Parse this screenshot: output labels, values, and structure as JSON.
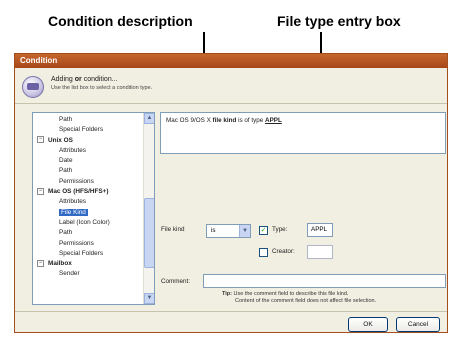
{
  "callouts": {
    "condition_description": "Condition description",
    "file_type_entry_box": "File type entry box"
  },
  "dialog": {
    "title": "Condition",
    "header_title_pre": "Adding ",
    "header_title_bold": "or",
    "header_title_post": " condition...",
    "header_subtitle": "Use the list box to select a condition type."
  },
  "tree": {
    "items": [
      {
        "label": "Path",
        "kind": "child"
      },
      {
        "label": "Special Folders",
        "kind": "child"
      },
      {
        "label": "Unix OS",
        "kind": "group",
        "expander": "−"
      },
      {
        "label": "Attributes",
        "kind": "child"
      },
      {
        "label": "Date",
        "kind": "child"
      },
      {
        "label": "Path",
        "kind": "child"
      },
      {
        "label": "Permissions",
        "kind": "child"
      },
      {
        "label": "Mac OS (HFS/HFS+)",
        "kind": "group",
        "expander": "−"
      },
      {
        "label": "Attributes",
        "kind": "child"
      },
      {
        "label": "File Kind",
        "kind": "child",
        "selected": true
      },
      {
        "label": "Label (Icon Color)",
        "kind": "child"
      },
      {
        "label": "Path",
        "kind": "child"
      },
      {
        "label": "Permissions",
        "kind": "child"
      },
      {
        "label": "Special Folders",
        "kind": "child"
      },
      {
        "label": "Mailbox",
        "kind": "group",
        "expander": "−"
      },
      {
        "label": "Sender",
        "kind": "child"
      }
    ],
    "scroll_up": "▲",
    "scroll_down": "▼"
  },
  "description": {
    "prefix": "Mac OS 9/OS X ",
    "bold": "file kind",
    "middle": " is of type ",
    "value": "APPL"
  },
  "form": {
    "file_kind_label": "File kind",
    "operator_value": "is",
    "combo_arrow": "▼",
    "type_label": "Type:",
    "type_checked": true,
    "type_check_mark": "✓",
    "type_value": "APPL",
    "creator_label": "Creator:",
    "creator_checked": false,
    "creator_value": "",
    "comment_label": "Comment:",
    "comment_value": "",
    "tip_label": "Tip:",
    "tip_line1": "Use the comment field to describe this file kind.",
    "tip_line2": "Content of the comment field does not affect file selection."
  },
  "buttons": {
    "ok": "OK",
    "cancel": "Cancel"
  }
}
